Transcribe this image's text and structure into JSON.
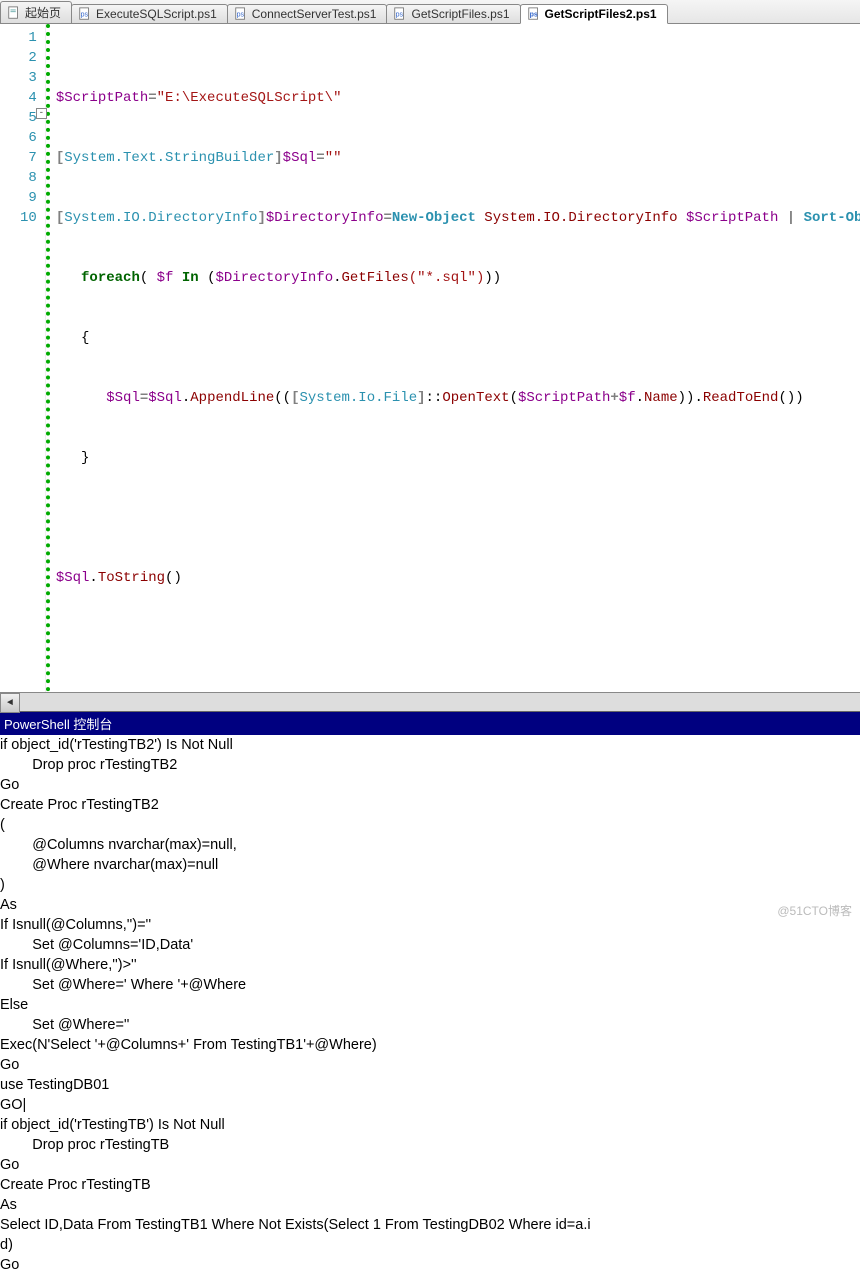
{
  "tabs": [
    {
      "label": "起始页",
      "active": false
    },
    {
      "label": "ExecuteSQLScript.ps1",
      "active": false
    },
    {
      "label": "ConnectServerTest.ps1",
      "active": false
    },
    {
      "label": "GetScriptFiles.ps1",
      "active": false
    },
    {
      "label": "GetScriptFiles2.ps1",
      "active": true
    }
  ],
  "line_numbers": [
    "1",
    "2",
    "3",
    "4",
    "5",
    "6",
    "7",
    "8",
    "9",
    "10"
  ],
  "code": {
    "l1": {
      "var": "$ScriptPath",
      "eq": "=",
      "str": "\"E:\\ExecuteSQLScript\\\""
    },
    "l2": {
      "open": "[",
      "type": "System.Text.StringBuilder",
      "close": "]",
      "var": "$Sql",
      "eq": "=",
      "str": "\"\""
    },
    "l3": {
      "open": "[",
      "type": "System.IO.DirectoryInfo",
      "close": "]",
      "var": "$DirectoryInfo",
      "eq": "=",
      "newobj": "New-Object",
      "resttype": " System.IO.DirectoryInfo",
      "arg": " $ScriptPath",
      "pipe": " |",
      "sort": " Sort-Object"
    },
    "l4": {
      "foreach": "foreach",
      "open": "( ",
      "var1": "$f",
      "in": " In ",
      "op": "(",
      "var2": "$DirectoryInfo",
      "dot": ".",
      "method": "GetFiles",
      "args": "(\"*.sql\")",
      "close": "))"
    },
    "l5": {
      "brace": "{"
    },
    "l6": {
      "var": "$Sql",
      "eq": "=",
      "var2": "$Sql",
      "dot": ".",
      "method": "AppendLine",
      "open": "((",
      "ob": "[",
      "type": "System.Io.File",
      "cb": "]",
      "cc": "::",
      "method2": "OpenText",
      "op2": "(",
      "var3": "$ScriptPath",
      "plus": "+",
      "var4": "$f",
      "dot2": ".",
      "prop": "Name",
      "close": "))",
      "dot3": ".",
      "method3": "ReadToEnd",
      "pp": "())"
    },
    "l7": {
      "brace": "}"
    },
    "l9": {
      "var": "$Sql",
      "dot": ".",
      "method": "ToString",
      "pp": "()"
    }
  },
  "panel_title": "PowerShell 控制台",
  "console": [
    "if object_id('rTestingTB2') Is Not Null",
    "        Drop proc rTestingTB2",
    "Go",
    "Create Proc rTestingTB2",
    "(",
    "        @Columns nvarchar(max)=null,",
    "        @Where nvarchar(max)=null",
    ")",
    "As",
    "If Isnull(@Columns,'')=''",
    "        Set @Columns='ID,Data'",
    "",
    "If Isnull(@Where,'')>''",
    "        Set @Where=' Where '+@Where",
    "Else",
    "        Set @Where=''",
    "",
    "Exec(N'Select '+@Columns+' From TestingTB1'+@Where)",
    "Go",
    "",
    "",
    "use TestingDB01",
    "GO|",
    "if object_id('rTestingTB') Is Not Null",
    "        Drop proc rTestingTB",
    "Go",
    "Create Proc rTestingTB",
    "As",
    "Select ID,Data From TestingTB1 Where Not Exists(Select 1 From TestingDB02 Where id=a.i",
    "d)",
    "Go"
  ],
  "watermark": "@51CTO博客"
}
